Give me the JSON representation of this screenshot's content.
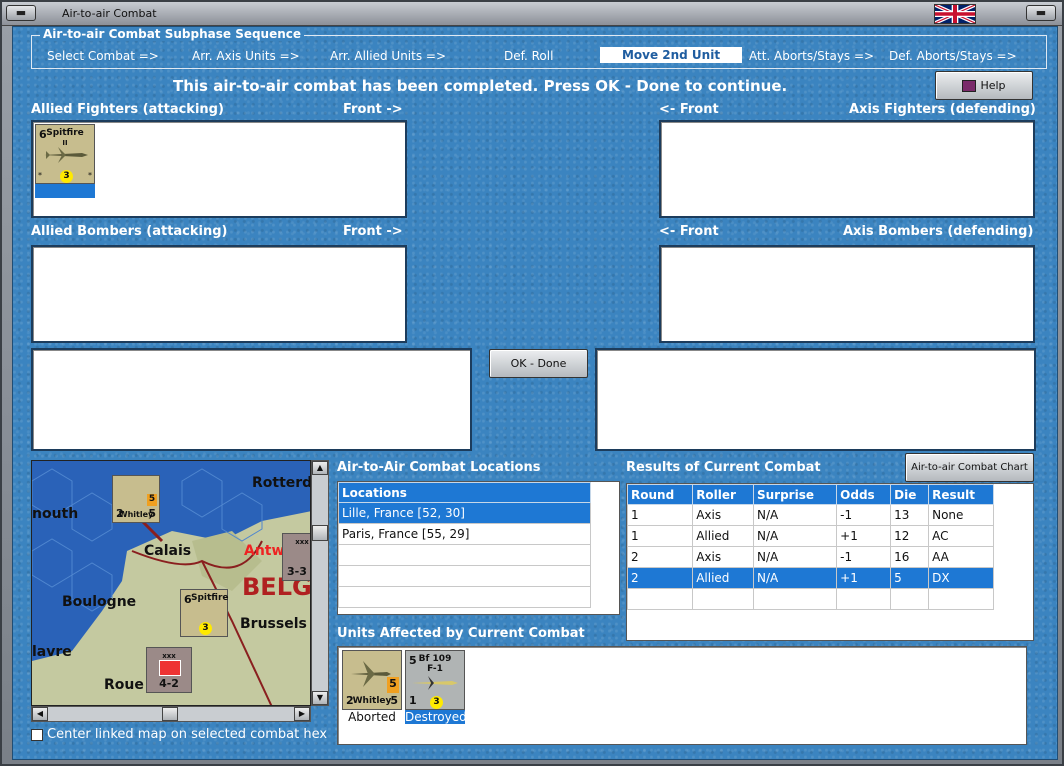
{
  "window": {
    "title": "Air-to-air Combat",
    "flag_icon": "uk-flag-icon"
  },
  "phase": {
    "legend": "Air-to-air Combat Subphase Sequence",
    "steps": [
      "Select Combat =>",
      "Arr. Axis Units =>",
      "Arr. Allied Units =>",
      "Def. Roll",
      "Move 2nd Unit",
      "Att. Aborts/Stays =>",
      "Def. Aborts/Stays =>"
    ],
    "active_index": 4
  },
  "message": "This air-to-air combat has been completed.  Press OK - Done to continue.",
  "help_label": "Help",
  "sections": {
    "allied_fighters": "Allied Fighters (attacking)",
    "allied_fighters_front": "Front ->",
    "axis_fighters_front": "<- Front",
    "axis_fighters": "Axis Fighters (defending)",
    "allied_bombers": "Allied Bombers (attacking)",
    "allied_bombers_front": "Front ->",
    "axis_bombers_front": "<- Front",
    "axis_bombers": "Axis Bombers (defending)"
  },
  "ok_done_label": "OK - Done",
  "chart_button_label": "Air-to-air Combat Chart",
  "spitfire_counter": {
    "name": "Spitfire",
    "mark": "II",
    "top_value": "6",
    "range": "3"
  },
  "locations": {
    "title": "Air-to-Air Combat Locations",
    "header": "Locations",
    "rows": [
      "Lille, France [52, 30]",
      "Paris, France [55, 29]"
    ],
    "selected_index": 0
  },
  "results": {
    "title": "Results of Current Combat",
    "headers": [
      "Round",
      "Roller",
      "Surprise",
      "Odds",
      "Die",
      "Result"
    ],
    "rows": [
      [
        "1",
        "Axis",
        "N/A",
        "-1",
        "13",
        "None"
      ],
      [
        "1",
        "Allied",
        "N/A",
        "+1",
        "12",
        "AC"
      ],
      [
        "2",
        "Axis",
        "N/A",
        "-1",
        "16",
        "AA"
      ],
      [
        "2",
        "Allied",
        "N/A",
        "+1",
        "5",
        "DX"
      ]
    ],
    "selected_index": 3
  },
  "affected": {
    "title": "Units Affected by Current Combat",
    "units": [
      {
        "name": "Whitley",
        "top": "",
        "bottom_left": "2",
        "bottom_right": "5",
        "range": "5",
        "status": "Aborted"
      },
      {
        "name": "Bf 109",
        "mark": "F-1",
        "top": "5",
        "bottom_left": "1",
        "range": "3",
        "status": "Destroyed"
      }
    ]
  },
  "map": {
    "labels": [
      "Rotterd",
      "nouth",
      "Calais",
      "Antw",
      "BELG",
      "Boulogne",
      "Brussels",
      "lavre",
      "Roue"
    ],
    "counters": [
      {
        "name": "Whitley",
        "top": "",
        "bl": "2",
        "br": "5",
        "range": "5"
      },
      {
        "name": "Spitfire",
        "mark": "II",
        "top": "6",
        "range": "3"
      },
      {
        "name": "xxx",
        "value": "4-2"
      },
      {
        "name": "xxx",
        "value": "3-3"
      }
    ],
    "center_checkbox_label": "Center linked map on selected combat hex"
  }
}
